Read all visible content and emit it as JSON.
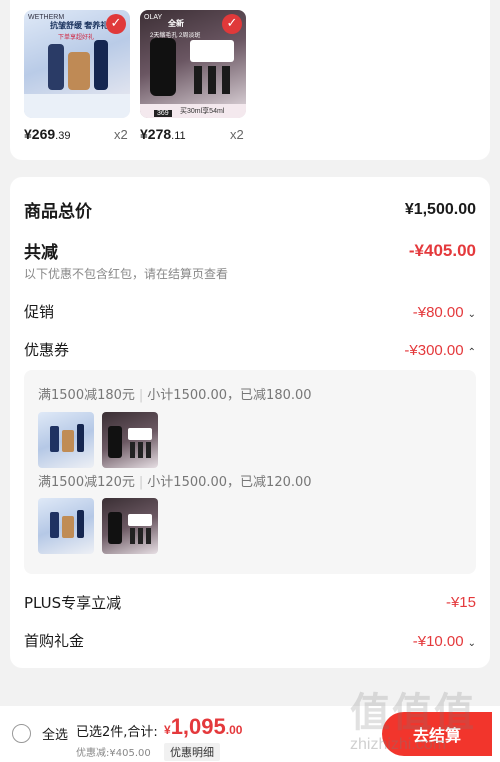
{
  "products": [
    {
      "brand": "WETHERM",
      "headline": "抗皱舒缓 奢养礼盒",
      "sub": "下单享超好礼",
      "price_int": "¥269",
      "price_dec": ".39",
      "qty": "x2",
      "selected_icon": "check-circle-icon"
    },
    {
      "brand": "OLAY",
      "headline": "全新",
      "sub": "2天缩毛孔 2周淡斑",
      "price_tag": "369",
      "price_note": "买30ml享54ml",
      "price_int": "¥278",
      "price_dec": ".11",
      "qty": "x2",
      "selected_icon": "check-circle-icon"
    }
  ],
  "summary": {
    "goods_total_label": "商品总价",
    "goods_total_value": "¥1,500.00",
    "discount_label": "共减",
    "discount_value": "-¥405.00",
    "discount_note": "以下优惠不包含红包，请在结算页查看",
    "promo_label": "促销",
    "promo_value": "-¥80.00",
    "coupon_label": "优惠券",
    "coupon_value": "-¥300.00",
    "coupon_lines": [
      {
        "rule": "满1500减180元",
        "detail": "小计1500.00，已减180.00"
      },
      {
        "rule": "满1500减120元",
        "detail": "小计1500.00，已减120.00"
      }
    ],
    "plus_label": "PLUS专享立减",
    "plus_value": "-¥15",
    "first_label": "首购礼金",
    "first_value": "-¥10.00"
  },
  "bottom_bar": {
    "select_all": "全选",
    "selected_count": "已选2件,合计:",
    "currency": "¥",
    "total_int": "1,095",
    "total_dec": ".00",
    "discount_note": "优惠减:¥405.00",
    "detail_link": "优惠明细",
    "checkout": "去结算"
  },
  "watermark": {
    "logo": "值值值",
    "site": "zhizhizhi.com"
  },
  "colors": {
    "accent_red": "#e4393c",
    "checkout_red": "#f2352c",
    "background": "#f2f2f2"
  }
}
